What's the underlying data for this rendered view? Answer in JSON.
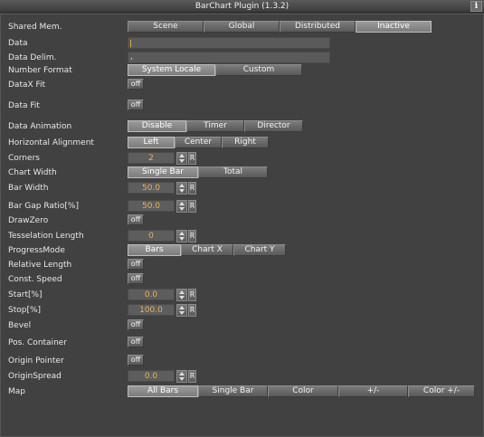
{
  "window": {
    "title": "BarChart Plugin (1.3.2)",
    "info_icon": "info-icon"
  },
  "rows": {
    "shared_mem": {
      "label": "Shared Mem.",
      "options": [
        "Scene",
        "Global",
        "Distributed",
        "Inactive"
      ],
      "selected": "Inactive"
    },
    "data": {
      "label": "Data",
      "value": ""
    },
    "data_delim": {
      "label": "Data Delim.",
      "value": ","
    },
    "number_format": {
      "label": "Number Format",
      "options": [
        "System Locale",
        "Custom"
      ],
      "selected": "System Locale"
    },
    "datax_fit": {
      "label": "DataX Fit",
      "value": "off"
    },
    "data_fit": {
      "label": "Data Fit",
      "value": "off"
    },
    "data_animation": {
      "label": "Data Animation",
      "options": [
        "Disable",
        "Timer",
        "Director"
      ],
      "selected": "Disable"
    },
    "horizontal_alignment": {
      "label": "Horizontal Alignment",
      "options": [
        "Left",
        "Center",
        "Right"
      ],
      "selected": "Left"
    },
    "corners": {
      "label": "Corners",
      "value": "2"
    },
    "chart_width": {
      "label": "Chart Width",
      "options": [
        "Single Bar",
        "Total"
      ],
      "selected": "Single Bar"
    },
    "bar_width": {
      "label": "Bar Width",
      "value": "50.0"
    },
    "bar_gap_ratio": {
      "label": "Bar Gap Ratio[%]",
      "value": "50.0"
    },
    "draw_zero": {
      "label": "DrawZero",
      "value": "off"
    },
    "tesselation_length": {
      "label": "Tesselation Length",
      "value": "0"
    },
    "progress_mode": {
      "label": "ProgressMode",
      "options": [
        "Bars",
        "Chart X",
        "Chart Y"
      ],
      "selected": "Bars"
    },
    "relative_length": {
      "label": "Relative Length",
      "value": "off"
    },
    "const_speed": {
      "label": "Const. Speed",
      "value": "off"
    },
    "start": {
      "label": "Start[%]",
      "value": "0.0"
    },
    "stop": {
      "label": "Stop[%]",
      "value": "100.0"
    },
    "bevel": {
      "label": "Bevel",
      "value": "off"
    },
    "pos_container": {
      "label": "Pos. Container",
      "value": "off"
    },
    "origin_pointer": {
      "label": "Origin Pointer",
      "value": "off"
    },
    "origin_spread": {
      "label": "OriginSpread",
      "value": "0.0"
    },
    "map": {
      "label": "Map",
      "options": [
        "All Bars",
        "Single Bar",
        "Color",
        "+/-",
        "Color +/-"
      ],
      "selected": "All Bars"
    }
  },
  "reset_label": "R",
  "colors": {
    "value_text": "#e8b25a",
    "background": "#414141"
  }
}
